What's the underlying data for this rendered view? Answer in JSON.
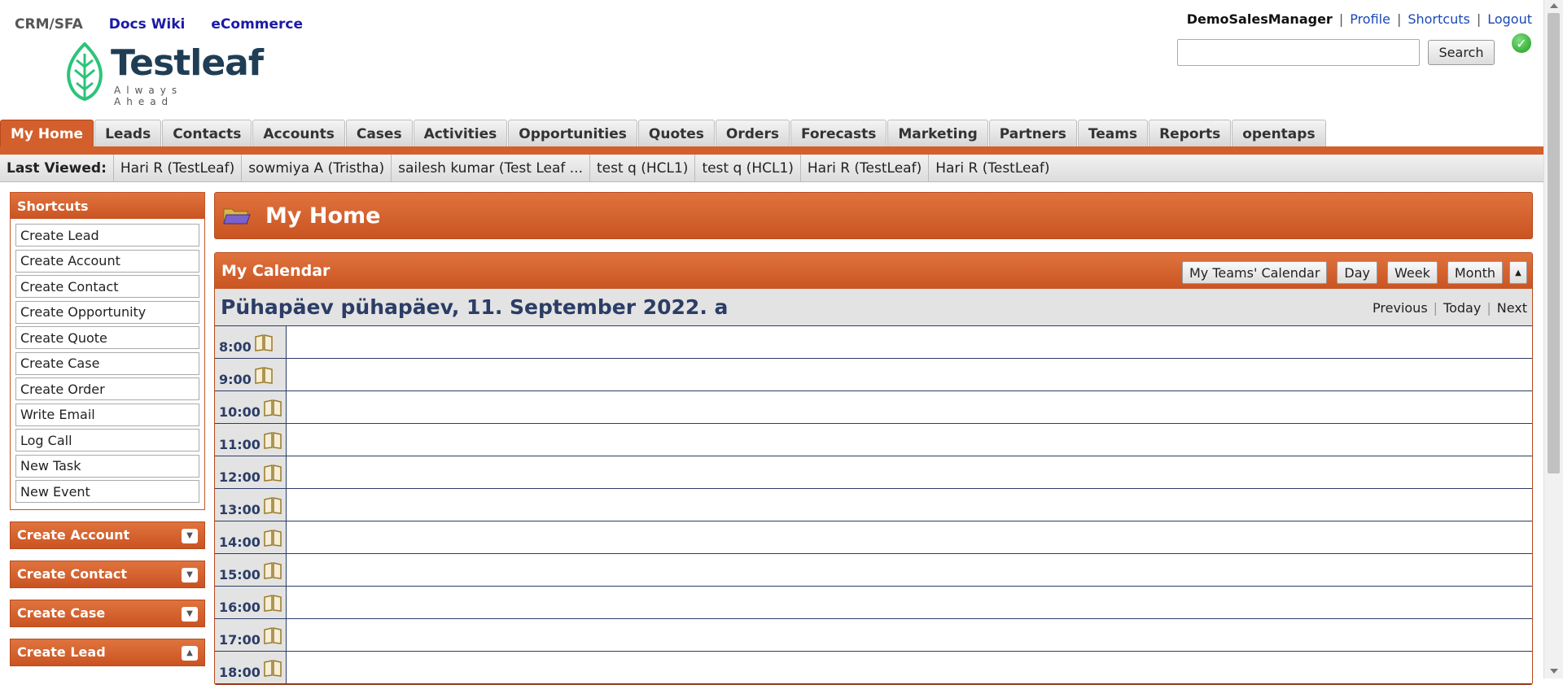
{
  "top_nav": {
    "app": "CRM/SFA",
    "docs": "Docs Wiki",
    "ecommerce": "eCommerce"
  },
  "logo": {
    "name": "Testleaf",
    "tagline": "Always Ahead"
  },
  "user": {
    "name": "DemoSalesManager",
    "profile": "Profile",
    "shortcuts": "Shortcuts",
    "logout": "Logout",
    "sep": "|"
  },
  "search": {
    "value": "",
    "button": "Search"
  },
  "tabs": [
    "My Home",
    "Leads",
    "Contacts",
    "Accounts",
    "Cases",
    "Activities",
    "Opportunities",
    "Quotes",
    "Orders",
    "Forecasts",
    "Marketing",
    "Partners",
    "Teams",
    "Reports",
    "opentaps"
  ],
  "last_viewed": {
    "label": "Last Viewed:",
    "items": [
      "Hari R (TestLeaf)",
      "sowmiya A (Tristha)",
      "sailesh kumar (Test Leaf ...",
      "test q (HCL1)",
      "test q (HCL1)",
      "Hari R (TestLeaf)",
      "Hari R (TestLeaf)"
    ]
  },
  "shortcuts": {
    "title": "Shortcuts",
    "items": [
      "Create Lead",
      "Create Account",
      "Create Contact",
      "Create Opportunity",
      "Create Quote",
      "Create Case",
      "Create Order",
      "Write Email",
      "Log Call",
      "New Task",
      "New Event"
    ]
  },
  "panels": [
    "Create Account",
    "Create Contact",
    "Create Case",
    "Create Lead"
  ],
  "page_title": "My Home",
  "calendar": {
    "title": "My Calendar",
    "buttons": [
      "My Teams' Calendar",
      "Day",
      "Week",
      "Month"
    ],
    "date": "Pühapäev pühapäev, 11. September 2022. a",
    "nav": [
      "Previous",
      "Today",
      "Next"
    ],
    "hours": [
      "8:00",
      "9:00",
      "10:00",
      "11:00",
      "12:00",
      "13:00",
      "14:00",
      "15:00",
      "16:00",
      "17:00",
      "18:00"
    ]
  },
  "colors": {
    "accent": "#d35f2c",
    "calendar_text": "#2b3d66",
    "link": "#1a48b8"
  },
  "icons": {
    "folder": "folder-icon",
    "book": "book-icon",
    "check": "check-icon"
  }
}
